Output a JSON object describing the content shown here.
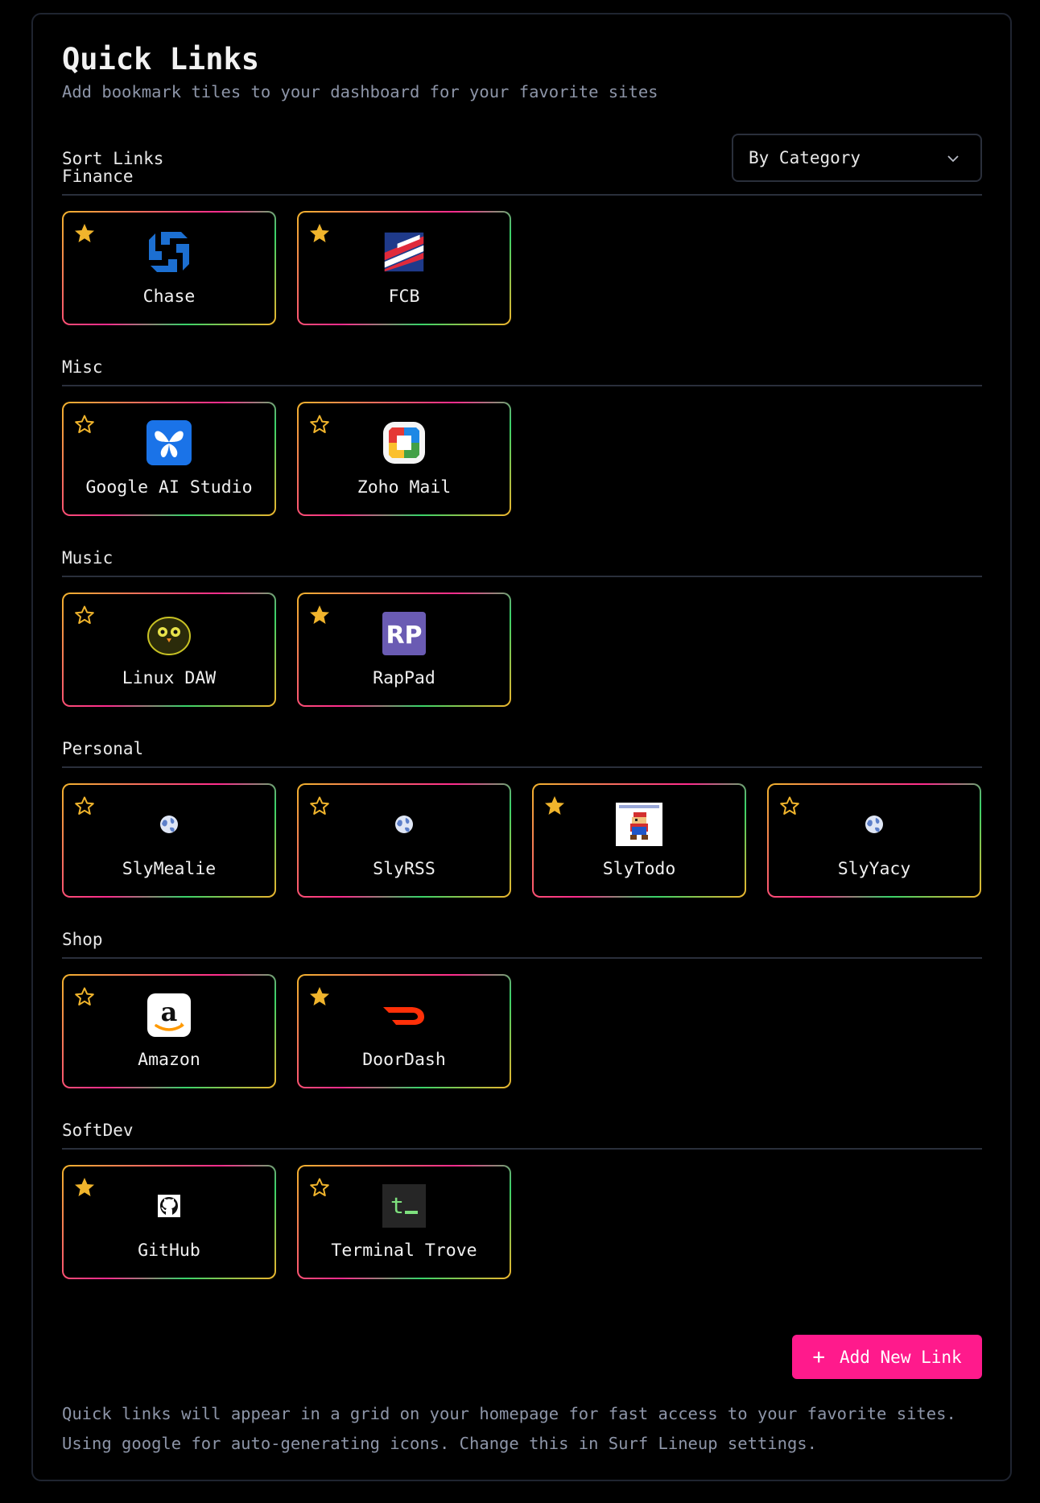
{
  "header": {
    "title": "Quick Links",
    "subtitle": "Add bookmark tiles to your dashboard for your favorite sites"
  },
  "sort": {
    "label": "Sort Links",
    "selected": "By Category"
  },
  "categories": [
    {
      "name": "Finance",
      "links": [
        {
          "name": "Chase",
          "favorite": true,
          "icon": "chase-logo-icon"
        },
        {
          "name": "FCB",
          "favorite": true,
          "icon": "fcb-flag-logo-icon"
        }
      ]
    },
    {
      "name": "Misc",
      "links": [
        {
          "name": "Google AI Studio",
          "favorite": false,
          "icon": "google-ai-studio-butterfly-icon"
        },
        {
          "name": "Zoho Mail",
          "favorite": false,
          "icon": "zoho-mail-icon"
        }
      ]
    },
    {
      "name": "Music",
      "links": [
        {
          "name": "Linux DAW",
          "favorite": false,
          "icon": "linux-daw-owl-icon"
        },
        {
          "name": "RapPad",
          "favorite": true,
          "icon": "rappad-rp-icon"
        }
      ]
    },
    {
      "name": "Personal",
      "links": [
        {
          "name": "SlyMealie",
          "favorite": false,
          "icon": "globe-icon"
        },
        {
          "name": "SlyRSS",
          "favorite": false,
          "icon": "globe-icon"
        },
        {
          "name": "SlyTodo",
          "favorite": true,
          "icon": "mario-sprite-icon"
        },
        {
          "name": "SlyYacy",
          "favorite": false,
          "icon": "globe-icon"
        }
      ]
    },
    {
      "name": "Shop",
      "links": [
        {
          "name": "Amazon",
          "favorite": false,
          "icon": "amazon-logo-icon"
        },
        {
          "name": "DoorDash",
          "favorite": true,
          "icon": "doordash-logo-icon"
        }
      ]
    },
    {
      "name": "SoftDev",
      "links": [
        {
          "name": "GitHub",
          "favorite": true,
          "icon": "github-logo-icon"
        },
        {
          "name": "Terminal Trove",
          "favorite": false,
          "icon": "terminal-prompt-icon"
        }
      ]
    }
  ],
  "add_button": {
    "label": "Add New Link",
    "icon": "plus-icon"
  },
  "footer": {
    "line1": "Quick links will appear in a grid on your homepage for fast access to your favorite sites.",
    "line2": "Using google for auto-generating icons. Change this in Surf Lineup settings."
  },
  "colors": {
    "accent": "#ff1a8c",
    "star": "#f0b42c",
    "muted_text": "#8d95a8",
    "border": "#2a2f3b"
  }
}
